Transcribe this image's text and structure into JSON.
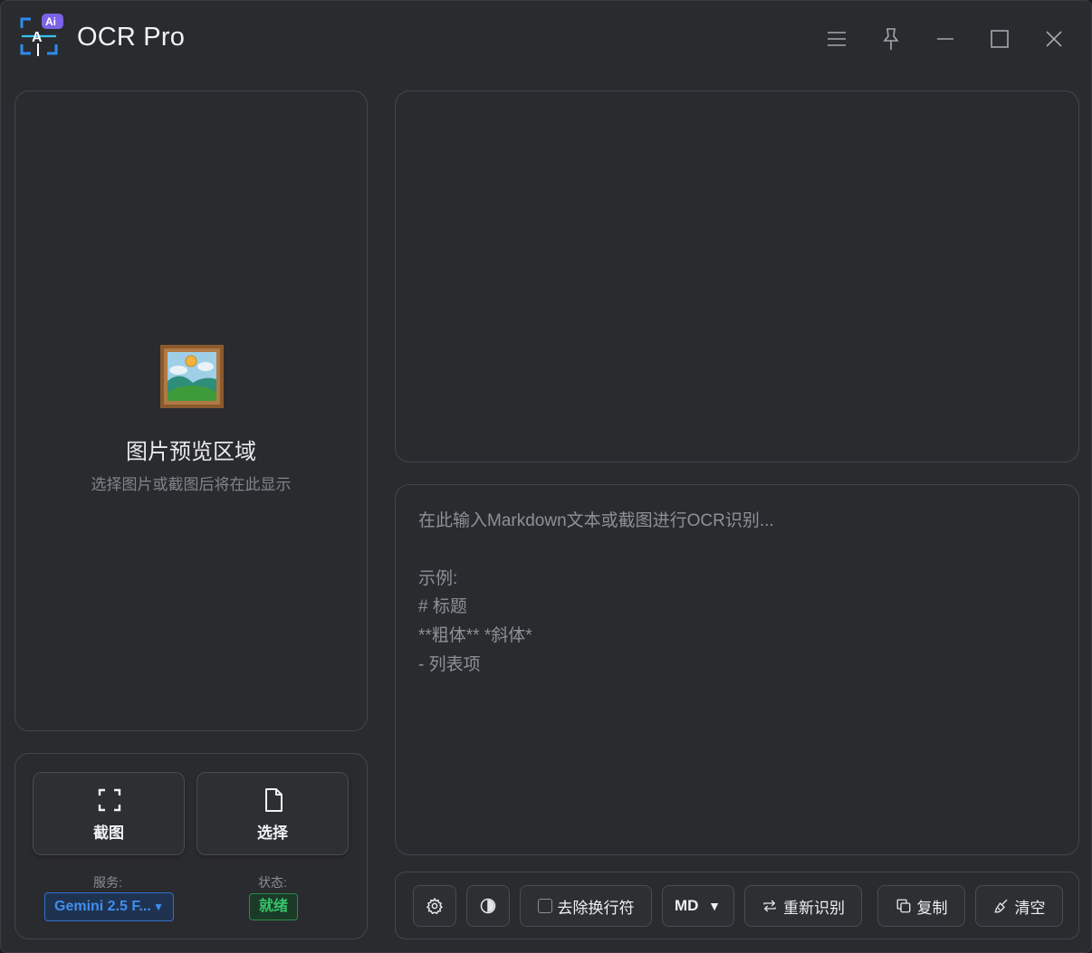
{
  "app": {
    "title": "OCR Pro",
    "logo_badge": "Ai",
    "logo_letter": "A"
  },
  "titlebar": {
    "icons": [
      "menu-icon",
      "pin-icon",
      "minimize-icon",
      "maximize-icon",
      "close-icon"
    ]
  },
  "preview": {
    "title": "图片预览区域",
    "subtitle": "选择图片或截图后将在此显示",
    "icon": "framed-picture-icon"
  },
  "actions": {
    "screenshot_label": "截图",
    "select_label": "选择"
  },
  "service": {
    "label": "服务:",
    "value": "Gemini 2.5 F...",
    "caret": "▼",
    "color": "#3f8ef0"
  },
  "status": {
    "label": "状态:",
    "value": "就绪",
    "color": "#36c46a"
  },
  "editor": {
    "placeholder": "在此输入Markdown文本或截图进行OCR识别...\n\n示例:\n# 标题\n**粗体** *斜体*\n- 列表项"
  },
  "toolbar": {
    "remove_newlines_label": "去除换行符",
    "remove_newlines_checked": false,
    "format_value": "MD",
    "format_caret": "▼",
    "rerecognize_label": "重新识别",
    "copy_label": "复制",
    "clear_label": "清空"
  }
}
